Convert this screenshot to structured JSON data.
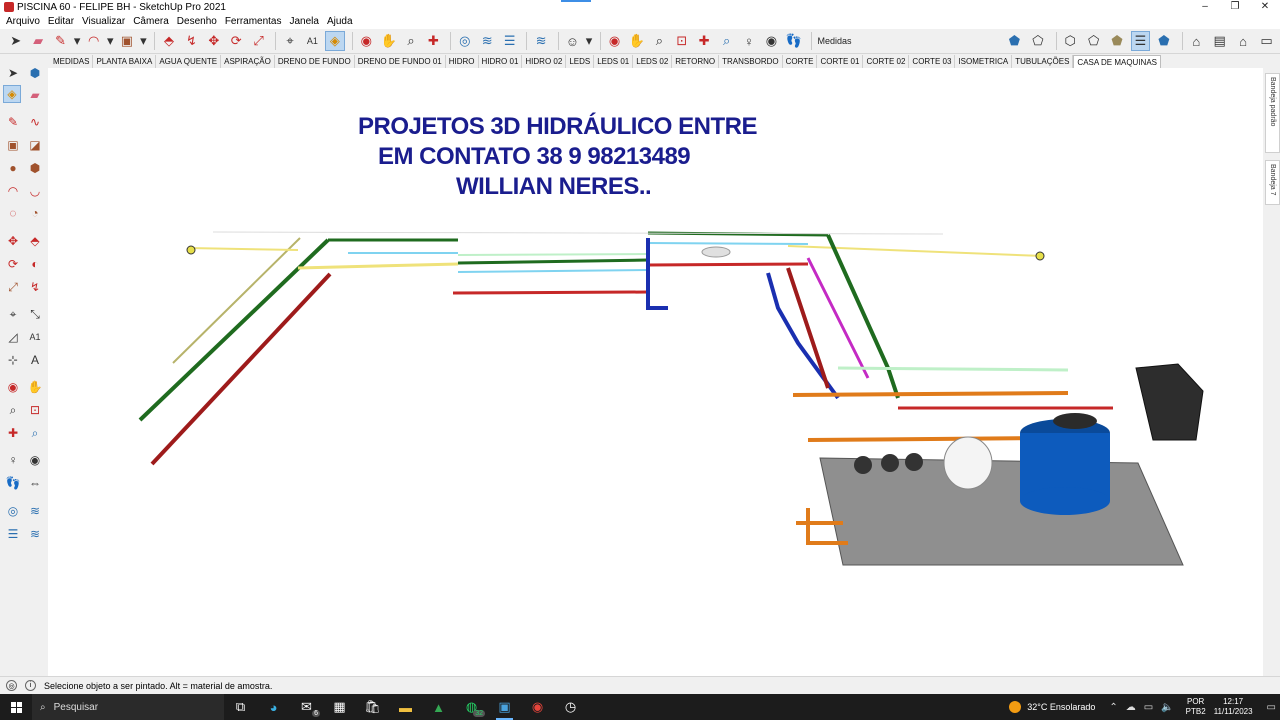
{
  "window": {
    "title": "PISCINA 60 - FELIPE BH - SketchUp Pro 2021",
    "controls": {
      "minimize": "–",
      "maximize": "❐",
      "close": "✕"
    }
  },
  "menu": [
    "Arquivo",
    "Editar",
    "Visualizar",
    "Câmera",
    "Desenho",
    "Ferramentas",
    "Janela",
    "Ajuda"
  ],
  "toolbar": {
    "measurements_label": "Medidas"
  },
  "scenes": [
    "MEDIDAS",
    "PLANTA BAIXA",
    "AGUA QUENTE",
    "ASPIRAÇÃO",
    "DRENO DE FUNDO",
    "DRENO DE FUNDO 01",
    "HIDRO",
    "HIDRO 01",
    "HIDRO 02",
    "LEDS",
    "LEDS 01",
    "LEDS 02",
    "RETORNO",
    "TRANSBORDO",
    "CORTE",
    "CORTE 01",
    "CORTE 02",
    "CORTE 03",
    "ISOMETRICA",
    "TUBULAÇÕES",
    "CASA DE MAQUINAS"
  ],
  "active_scene": "CASA DE MAQUINAS",
  "viewport": {
    "text_lines": [
      "PROJETOS 3D HIDRÁULICO ENTRE",
      "EM CONTATO 38 9 98213489",
      "WILLIAN NERES.."
    ]
  },
  "trays": [
    "Bandeja padrão",
    "Bandeja 7"
  ],
  "status": {
    "message": "Selecione objeto a ser pintado. Alt = material de amostra."
  },
  "taskbar": {
    "search_placeholder": "Pesquisar",
    "mail_badge": "6",
    "whatsapp_badge": "32",
    "weather": "32°C  Ensolarado",
    "lang_top": "POR",
    "lang_bottom": "PTB2",
    "time": "12:17",
    "date": "11/11/2023"
  },
  "colors": {
    "promo_text": "#1a1d8e",
    "pipe_green": "#1f6b1f",
    "pipe_red": "#9e1b1b",
    "pipe_orange": "#e07b1a",
    "pipe_blue": "#1a2fb0",
    "pipe_cyan": "#7fd3f0",
    "pipe_yellow": "#efe27a",
    "pipe_magenta": "#c42ac4",
    "tank_blue": "#0d5bbd"
  }
}
